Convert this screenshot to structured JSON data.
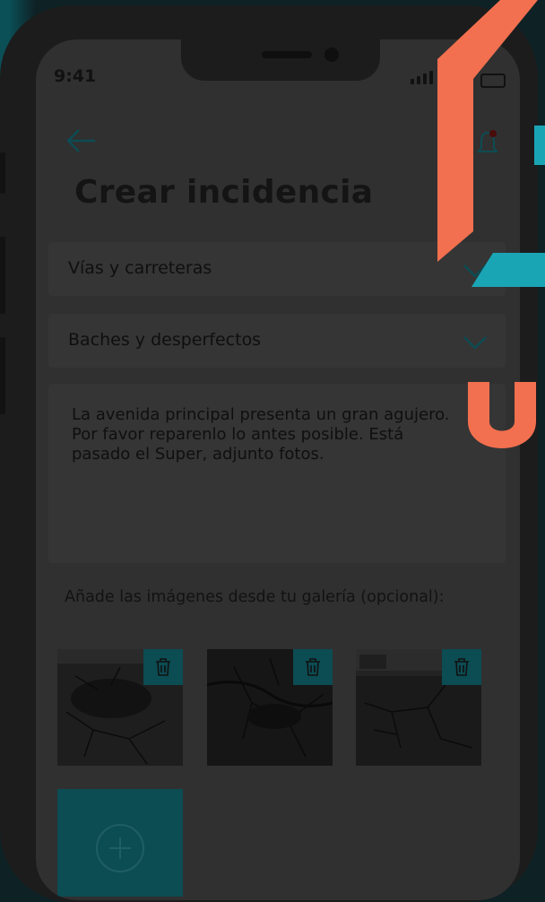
{
  "status_bar": {
    "time": "9:41"
  },
  "header": {
    "back_icon": "arrow-left-icon",
    "notification_icon": "bell-icon",
    "title": "Crear incidencia"
  },
  "form": {
    "category": {
      "value": "Vías y carreteras",
      "icon": "chevron-down-icon"
    },
    "subcategory": {
      "value": "Baches y desperfectos",
      "icon": "chevron-down-icon"
    },
    "description": "La avenida principal presenta un gran agujero. Por favor reparenlo lo antes posible. Está pasado el Super, adjunto fotos.",
    "gallery_label": "Añade las imágenes desde tu galería (opcional):",
    "images": [
      {
        "delete_icon": "trash-icon"
      },
      {
        "delete_icon": "trash-icon"
      },
      {
        "delete_icon": "trash-icon"
      }
    ],
    "add_icon": "plus-circle-icon"
  },
  "colors": {
    "accent_teal": "#0c4c53",
    "brand_orange": "#f2704f",
    "brand_cyan": "#1aa5b5",
    "screen_overlay": "#303030"
  }
}
